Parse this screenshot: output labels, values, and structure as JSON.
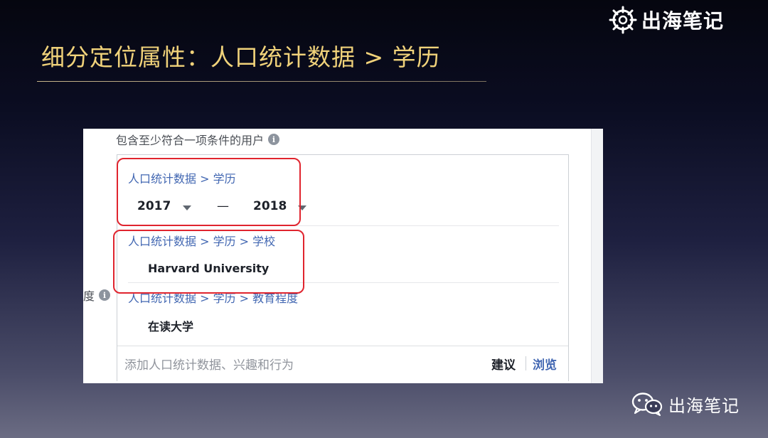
{
  "slide": {
    "title": "细分定位属性：人口统计数据 > 学历",
    "brand_top": "出海笔记",
    "brand_bottom": "出海笔记"
  },
  "panel": {
    "include_label": "包含至少符合一项条件的用户",
    "side_label": "度",
    "criteria": [
      {
        "path": "人口统计数据 > 学历",
        "year_from": "2017",
        "year_sep": "—",
        "year_to": "2018"
      },
      {
        "path": "人口统计数据 > 学历 > 学校",
        "value": "Harvard University"
      },
      {
        "path": "人口统计数据 > 学历 > 教育程度",
        "value": "在读大学"
      }
    ],
    "add_placeholder": "添加人口统计数据、兴趣和行为",
    "suggest_label": "建议",
    "browse_label": "浏览"
  },
  "colors": {
    "title_gold": "#f0d27a",
    "link_blue": "#4267b2",
    "highlight_red": "#e0242e"
  },
  "icons": [
    "ship-wheel-logo-icon",
    "info-icon",
    "caret-down-icon",
    "wechat-icon"
  ]
}
